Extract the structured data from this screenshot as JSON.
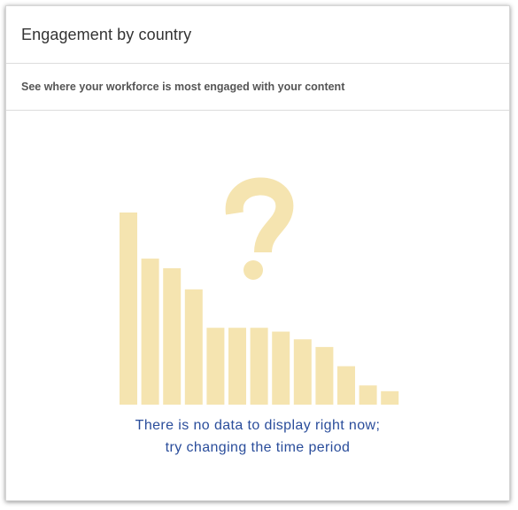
{
  "card": {
    "title": "Engagement by country",
    "subtitle": "See where your workforce is most engaged with your content"
  },
  "empty_state": {
    "line1": "There is no data to display right now;",
    "line2": "try changing the time period",
    "illustration_color": "#f5e4b0",
    "illustration_icon": "question-mark-icon",
    "bar_levels": [
      1.0,
      0.76,
      0.71,
      0.6,
      0.4,
      0.4,
      0.4,
      0.38,
      0.34,
      0.3,
      0.2,
      0.1,
      0.07
    ]
  },
  "colors": {
    "message": "#2a4d9b",
    "title": "#333333",
    "subtitle": "#555555",
    "divider": "#dcdcdc"
  }
}
